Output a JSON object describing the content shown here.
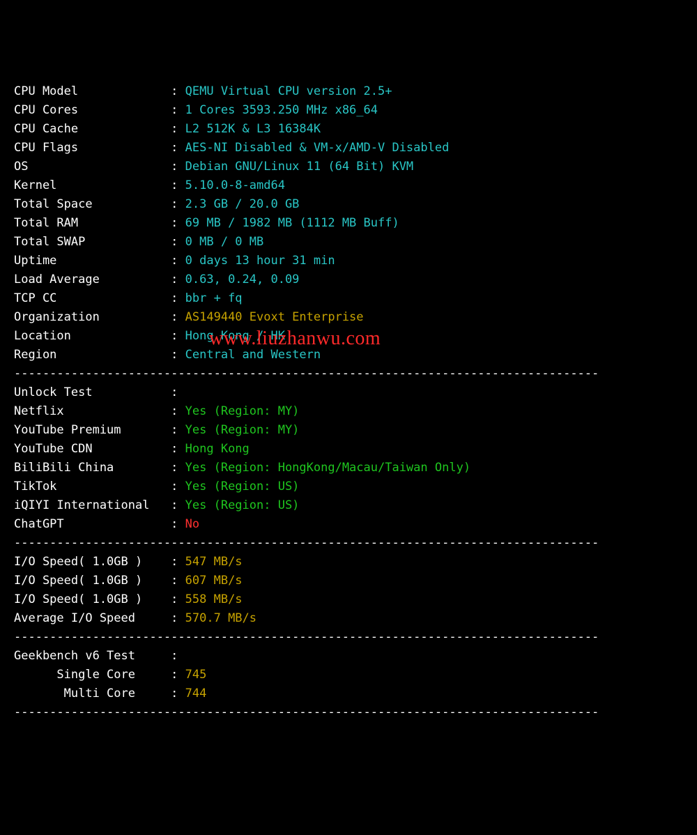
{
  "labelWidth": 22,
  "divider": "----------------------------------------------------------------------------------",
  "padLabels": {
    "geekbench_header": "Geekbench v6 Test",
    "single_core": "      Single Core",
    "multi_core": "       Multi Core"
  },
  "sections": [
    {
      "rows": [
        {
          "label": "CPU Model",
          "value": "QEMU Virtual CPU version 2.5+",
          "color": "c-cyan"
        },
        {
          "label": "CPU Cores",
          "value": "1 Cores 3593.250 MHz x86_64",
          "color": "c-cyan"
        },
        {
          "label": "CPU Cache",
          "value": "L2 512K & L3 16384K",
          "color": "c-cyan"
        },
        {
          "label": "CPU Flags",
          "value": "AES-NI Disabled & VM-x/AMD-V Disabled",
          "color": "c-cyan"
        },
        {
          "label": "OS",
          "value": "Debian GNU/Linux 11 (64 Bit) KVM",
          "color": "c-cyan"
        },
        {
          "label": "Kernel",
          "value": "5.10.0-8-amd64",
          "color": "c-cyan"
        },
        {
          "label": "Total Space",
          "value": "2.3 GB / 20.0 GB",
          "color": "c-cyan"
        },
        {
          "label": "Total RAM",
          "value": "69 MB / 1982 MB (1112 MB Buff)",
          "color": "c-cyan"
        },
        {
          "label": "Total SWAP",
          "value": "0 MB / 0 MB",
          "color": "c-cyan"
        },
        {
          "label": "Uptime",
          "value": "0 days 13 hour 31 min",
          "color": "c-cyan"
        },
        {
          "label": "Load Average",
          "value": "0.63, 0.24, 0.09",
          "color": "c-cyan"
        },
        {
          "label": "TCP CC",
          "value": "bbr + fq",
          "color": "c-cyan"
        },
        {
          "label": "Organization",
          "value": "AS149440 Evoxt Enterprise",
          "color": "c-yellow"
        },
        {
          "label": "Location",
          "value": "Hong Kong / HK",
          "color": "c-cyan"
        },
        {
          "label": "Region",
          "value": "Central and Western",
          "color": "c-cyan"
        }
      ]
    },
    {
      "rows": [
        {
          "label": "Unlock Test",
          "value": "",
          "color": ""
        },
        {
          "label": "Netflix",
          "value": "Yes (Region: MY)",
          "color": "c-green"
        },
        {
          "label": "YouTube Premium",
          "value": "Yes (Region: MY)",
          "color": "c-green"
        },
        {
          "label": "YouTube CDN",
          "value": "Hong Kong",
          "color": "c-green"
        },
        {
          "label": "BiliBili China",
          "value": "Yes (Region: HongKong/Macau/Taiwan Only)",
          "color": "c-green"
        },
        {
          "label": "TikTok",
          "value": "Yes (Region: US)",
          "color": "c-green"
        },
        {
          "label": "iQIYI International",
          "value": "Yes (Region: US)",
          "color": "c-green"
        },
        {
          "label": "ChatGPT",
          "value": "No",
          "color": "c-red"
        }
      ]
    },
    {
      "rows": [
        {
          "label": "I/O Speed( 1.0GB )",
          "value": "547 MB/s",
          "color": "c-yellow"
        },
        {
          "label": "I/O Speed( 1.0GB )",
          "value": "607 MB/s",
          "color": "c-yellow"
        },
        {
          "label": "I/O Speed( 1.0GB )",
          "value": "558 MB/s",
          "color": "c-yellow"
        },
        {
          "label": "Average I/O Speed",
          "value": "570.7 MB/s",
          "color": "c-yellow"
        }
      ]
    },
    {
      "rows": [
        {
          "labelKey": "geekbench_header",
          "value": "",
          "color": ""
        },
        {
          "labelKey": "single_core",
          "value": "745",
          "color": "c-yellow"
        },
        {
          "labelKey": "multi_core",
          "value": "744",
          "color": "c-yellow"
        }
      ]
    }
  ],
  "watermark": "www.liuzhanwu.com"
}
